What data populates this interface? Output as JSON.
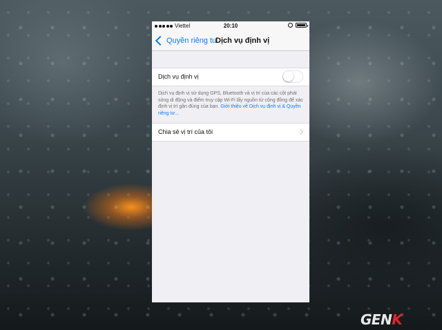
{
  "status_bar": {
    "carrier": "Viettel",
    "time": "20:10",
    "battery_level_percent": 100
  },
  "nav_bar": {
    "back_label": "Quyền riêng tư",
    "title": "Dịch vụ định vị"
  },
  "location_services": {
    "label": "Dịch vụ định vị",
    "enabled": false,
    "footer_text": "Dịch vụ định vị sử dụng GPS, Bluetooth và vị trí của các cột phát sóng di động và điểm truy cập Wi-Fi lấy nguồn từ cộng đồng để xác định vị trí gần đúng của bạn. ",
    "footer_link": "Giới thiệu về Dịch vụ định vị & Quyền riêng tư..."
  },
  "share_location": {
    "label": "Chia sẻ vị trí của tôi"
  },
  "watermark": {
    "text_main": "GEN",
    "text_accent": "K"
  },
  "colors": {
    "accent": "#0a7aff",
    "background_grouped": "#efeff4",
    "logo_accent": "#e2232a"
  },
  "icons": [
    "signal-dots-icon",
    "rotation-lock-icon",
    "battery-icon",
    "chevron-left-icon",
    "chevron-right-icon"
  ]
}
